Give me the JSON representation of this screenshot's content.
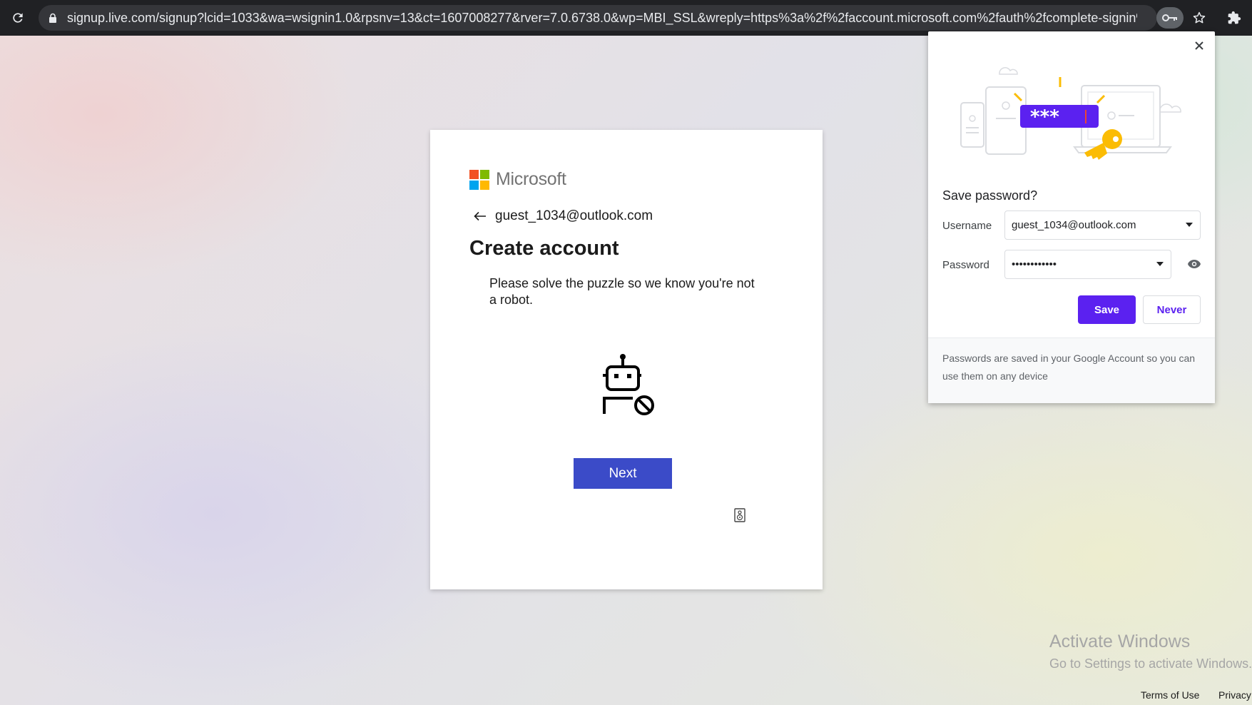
{
  "browser": {
    "url": "signup.live.com/signup?lcid=1033&wa=wsignin1.0&rpsnv=13&ct=1607008277&rver=7.0.6738.0&wp=MBI_SSL&wreply=https%3a%2f%2faccount.microsoft.com%2fauth%2fcomplete-signin%3fr...",
    "icons": [
      "reload-icon",
      "lock-icon",
      "key-icon",
      "star-icon",
      "puzzle-icon"
    ]
  },
  "signup": {
    "brand": "Microsoft",
    "identity": "guest_1034@outlook.com",
    "title": "Create account",
    "description": "Please solve the puzzle so we know you're not a robot.",
    "next_label": "Next"
  },
  "password_prompt": {
    "title": "Save password?",
    "username_label": "Username",
    "username_value": "guest_1034@outlook.com",
    "password_label": "Password",
    "password_value": "••••••••••••",
    "save_label": "Save",
    "never_label": "Never",
    "footer": "Passwords are saved in your Google Account so you can use them on any device",
    "illustration_text": "***"
  },
  "watermark": {
    "title": "Activate Windows",
    "subtitle": "Go to Settings to activate Windows."
  },
  "footer_links": {
    "terms": "Terms of Use",
    "privacy": "Privacy"
  },
  "colors": {
    "toolbar": "#202124",
    "next_button": "#3b4bc8",
    "save_button": "#5b21f0",
    "ms_red": "#f25022",
    "ms_green": "#7fba00",
    "ms_blue": "#00a4ef",
    "ms_yellow": "#ffb900"
  }
}
